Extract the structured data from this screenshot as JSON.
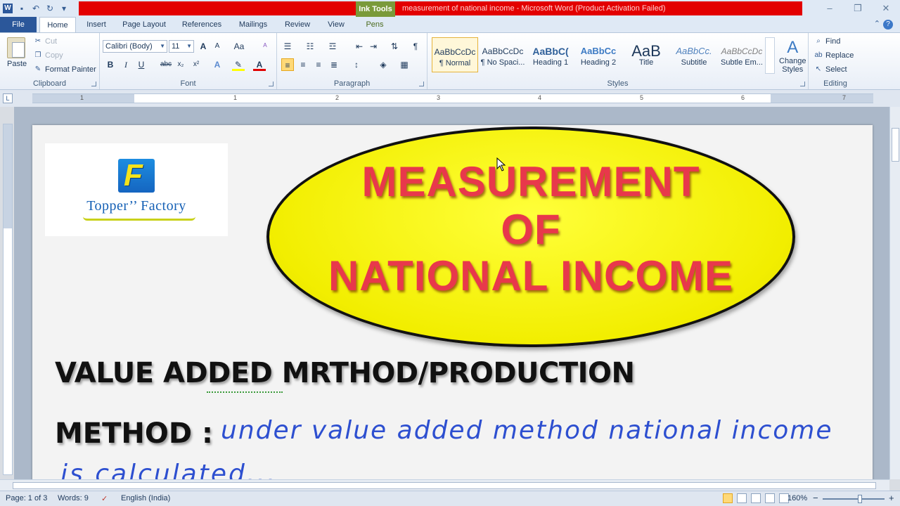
{
  "titlebar": {
    "context_tab": "Ink Tools",
    "doc_title": "measurement of national income  -  Microsoft Word (Product Activation Failed)",
    "min_glyph": "–",
    "max_glyph": "❐",
    "close_glyph": "✕"
  },
  "tabs": {
    "file": "File",
    "home": "Home",
    "insert": "Insert",
    "page_layout": "Page Layout",
    "references": "References",
    "mailings": "Mailings",
    "review": "Review",
    "view": "View",
    "pens": "Pens"
  },
  "clipboard": {
    "paste": "Paste",
    "cut": "Cut",
    "copy": "Copy",
    "format_painter": "Format Painter",
    "label": "Clipboard"
  },
  "font": {
    "name": "Calibri (Body)",
    "size": "11",
    "label": "Font",
    "bold": "B",
    "italic": "I",
    "underline": "U",
    "strike": "abc",
    "sub": "x₂",
    "sup": "x²",
    "grow": "A",
    "shrink": "A",
    "case": "Aa",
    "clear": "ᴬ"
  },
  "paragraph": {
    "label": "Paragraph",
    "pilcrow": "¶"
  },
  "styles": {
    "label": "Styles",
    "items": [
      {
        "sample": "AaBbCcDc",
        "name": "¶ Normal"
      },
      {
        "sample": "AaBbCcDc",
        "name": "¶ No Spaci..."
      },
      {
        "sample": "AaBbC(",
        "name": "Heading 1"
      },
      {
        "sample": "AaBbCc",
        "name": "Heading 2"
      },
      {
        "sample": "AaB",
        "name": "Title"
      },
      {
        "sample": "AaBbCc.",
        "name": "Subtitle"
      },
      {
        "sample": "AaBbCcDc",
        "name": "Subtle Em..."
      }
    ],
    "change": "Change",
    "change2": "Styles"
  },
  "editing": {
    "label": "Editing",
    "find": "Find",
    "replace": "Replace",
    "select": "Select"
  },
  "ruler": {
    "corner": "L",
    "numbers": [
      "1",
      "1",
      "2",
      "3",
      "4",
      "5",
      "6",
      "7"
    ]
  },
  "document": {
    "logo_letter": "F",
    "logo_text": "Topper’’ Factory",
    "title_lines": [
      "MEASUREMENT",
      "OF",
      "NATIONAL INCOME"
    ],
    "heading1": "VALUE  ADDED MRTHOD/PRODUCTION",
    "heading2": "METHOD :",
    "handwriting1": "under value added method national income",
    "handwriting2": "is calculated..."
  },
  "status": {
    "page": "Page: 1 of 3",
    "words": "Words: 9",
    "language": "English (India)",
    "zoom": "160%",
    "minus": "−",
    "plus": "+"
  },
  "colors": {
    "title_red_bar": "#e30000",
    "ellipse_fill": "#ffff00",
    "title_text": "#e8384b",
    "handwriting_blue": "#2d4fd0"
  }
}
